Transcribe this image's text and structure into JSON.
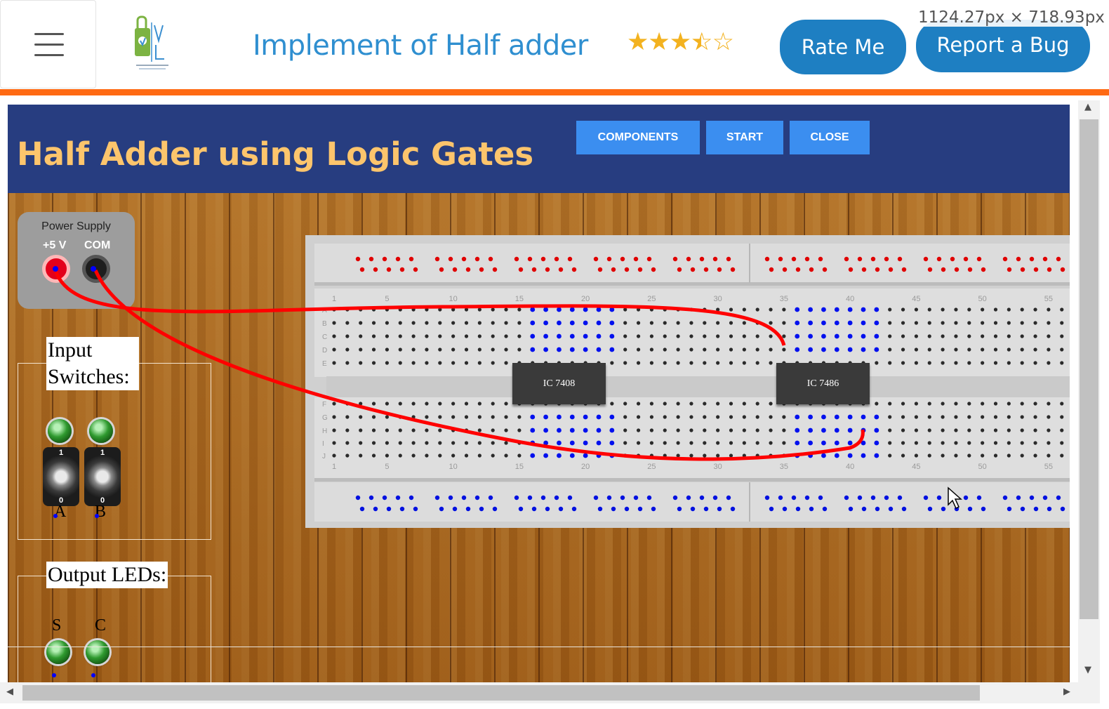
{
  "header": {
    "menu_icon": "hamburger-menu-icon",
    "logo_alt": "Virtual Labs",
    "title": "Implement of Half adder",
    "rating": 3.5,
    "rating_max": 5,
    "rate_button": "Rate Me",
    "bug_button": "Report a Bug",
    "dimension_tooltip": "1124.27px × 718.93px",
    "accent_color": "#ff6a13",
    "button_color": "#1e7fc2"
  },
  "simulator": {
    "title": "Half Adder using Logic Gates",
    "buttons": {
      "components": "COMPONENTS",
      "start": "START",
      "close": "CLOSE"
    },
    "power_supply": {
      "title": "Power Supply",
      "plus_label": "+5 V",
      "com_label": "COM"
    },
    "input_panel": {
      "label": "Input Switches:",
      "switch_a": "A",
      "switch_b": "B",
      "switch_on": "1",
      "switch_off": "0"
    },
    "output_panel": {
      "label": "Output LEDs:",
      "led_s": "S",
      "led_c": "C"
    },
    "chips": [
      {
        "name": "IC 7408"
      },
      {
        "name": "IC 7486"
      }
    ],
    "breadboard_columns": [
      "1",
      "5",
      "10",
      "15",
      "20",
      "25",
      "30",
      "35",
      "40",
      "45",
      "50",
      "55"
    ],
    "top_rows": [
      "A",
      "B",
      "C",
      "D",
      "E"
    ],
    "bottom_rows": [
      "F",
      "G",
      "H",
      "I",
      "J"
    ],
    "colors": {
      "title_bar": "#273d80",
      "title_text": "#fdc56c",
      "button": "#3b8ef0",
      "wire": "#ff0000",
      "active_hole": "#0000ff"
    }
  }
}
